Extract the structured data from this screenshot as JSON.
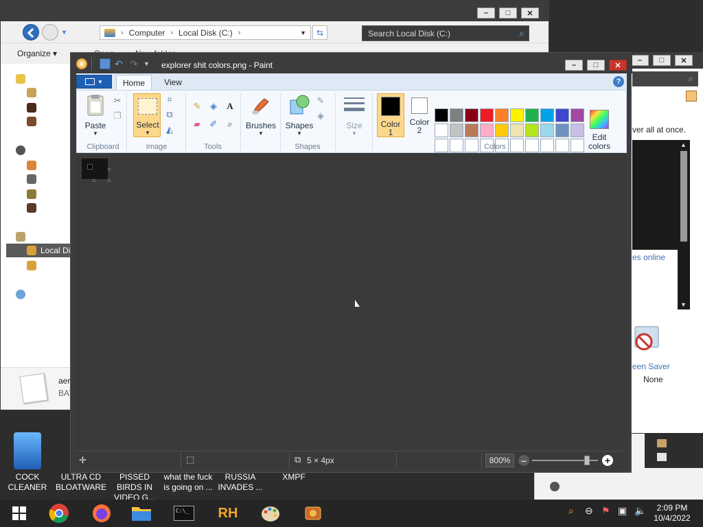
{
  "explorer": {
    "address": {
      "crumbs": [
        "Computer",
        "Local Disk (C:)"
      ]
    },
    "search_placeholder": "Search Local Disk (C:)",
    "organize_label": "Organize ▾",
    "cmd_open": "Open",
    "cmd_new_folder": "New folder",
    "sidebar_selected": "Local Di",
    "details": {
      "name": "aer",
      "type": "BAT"
    }
  },
  "right_dialog": {
    "text_partial": "ver all at once.",
    "link_partial": "es online",
    "screensaver_label": "een Saver",
    "screensaver_value": "None"
  },
  "desktop_icons": [
    {
      "label": "COCK CLEANER"
    },
    {
      "label": "ULTRA CD BLOATWARE"
    },
    {
      "label": "PISSED BIRDS IN VIDEO G..."
    },
    {
      "label": "what the fuck is going on ..."
    },
    {
      "label": "RUSSIA INVADES ..."
    },
    {
      "label": "XMPF"
    }
  ],
  "paint": {
    "title": "explorer shit colors.png - Paint",
    "tabs": {
      "home": "Home",
      "view": "View"
    },
    "groups": {
      "clipboard": "Clipboard",
      "image": "Image",
      "tools": "Tools",
      "shapes": "Shapes",
      "colors": "Colors"
    },
    "buttons": {
      "paste": "Paste",
      "select": "Select",
      "brushes": "Brushes",
      "shapes": "Shapes",
      "size": "Size",
      "color1": "Color 1",
      "color2": "Color 2",
      "edit_colors": "Edit colors"
    },
    "color1": "#000000",
    "color2": "#ffffff",
    "palette": [
      "#000000",
      "#7f7f7f",
      "#880015",
      "#ed1c24",
      "#ff7f27",
      "#fff200",
      "#22b14c",
      "#00a2e8",
      "#3f48cc",
      "#a349a4",
      "#ffffff",
      "#c3c3c3",
      "#b97a57",
      "#ffaec9",
      "#ffc90e",
      "#efe4b0",
      "#b5e61d",
      "#99d9ea",
      "#7092be",
      "#c8bfe7",
      "#ffffff",
      "#ffffff",
      "#ffffff",
      "#ffffff",
      "#ffffff",
      "#ffffff",
      "#ffffff",
      "#ffffff",
      "#ffffff",
      "#ffffff"
    ],
    "status": {
      "image_size": "5 × 4px",
      "zoom": "800%",
      "zoom_level": 0.83
    }
  },
  "taskbar": {
    "apps": [
      "start-button",
      "chrome",
      "firefox",
      "file-explorer",
      "command-prompt",
      "rh-app",
      "paint",
      "xmpf-app"
    ],
    "time": "2:09 PM",
    "date": "10/4/2022"
  },
  "colors": {
    "accent": "#1f5fb4",
    "dark_bg": "#2d2d2d",
    "close_red": "#c8352b",
    "select_highlight": "#fcd88b"
  }
}
